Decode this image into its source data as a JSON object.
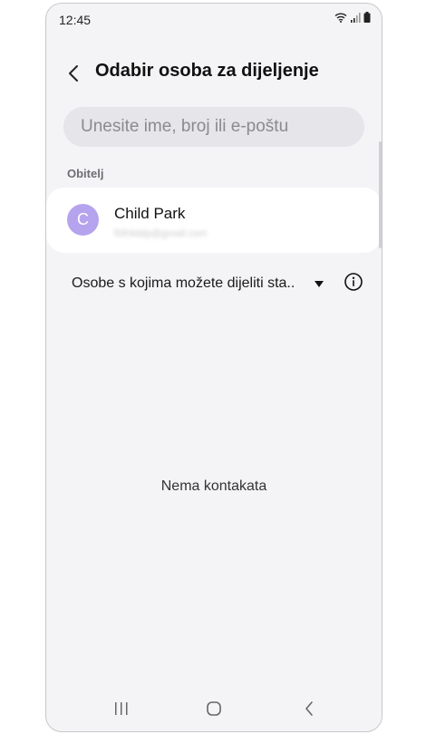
{
  "status_bar": {
    "time": "12:45"
  },
  "header": {
    "title": "Odabir osoba za dijeljenje"
  },
  "search": {
    "placeholder": "Unesite ime, broj ili e-poštu"
  },
  "family_section": {
    "label": "Obitelj",
    "contact": {
      "initial": "C",
      "name": "Child Park",
      "subtitle": "f0ihilddp@gmail.com"
    }
  },
  "filter": {
    "label": "Osobe s kojima možete dijeliti sta.."
  },
  "empty_state": {
    "text": "Nema kontakata"
  },
  "colors": {
    "accent_avatar": "#b6a3ee",
    "background": "#f4f4f6"
  }
}
